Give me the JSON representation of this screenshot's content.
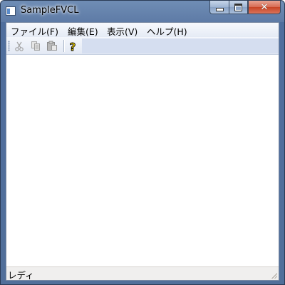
{
  "window": {
    "title": "SampleFVCL"
  },
  "caption_buttons": {
    "minimize_icon": "minimize-icon",
    "maximize_icon": "maximize-icon",
    "close_icon": "close-icon",
    "close_glyph": "✕"
  },
  "menu": {
    "items": [
      {
        "label": "ファイル(F)"
      },
      {
        "label": "編集(E)"
      },
      {
        "label": "表示(V)"
      },
      {
        "label": "ヘルプ(H)"
      }
    ]
  },
  "toolbar": {
    "buttons": [
      {
        "icon": "cut-icon",
        "enabled": false
      },
      {
        "icon": "copy-icon",
        "enabled": false
      },
      {
        "icon": "paste-icon",
        "enabled": false
      },
      {
        "icon": "help-icon",
        "enabled": true
      }
    ],
    "help_glyph": "?"
  },
  "status": {
    "text": "レディ"
  },
  "colors": {
    "accent": "#5e7ba6",
    "client_bg": "#ffffff",
    "status_bg": "#f0efee"
  }
}
